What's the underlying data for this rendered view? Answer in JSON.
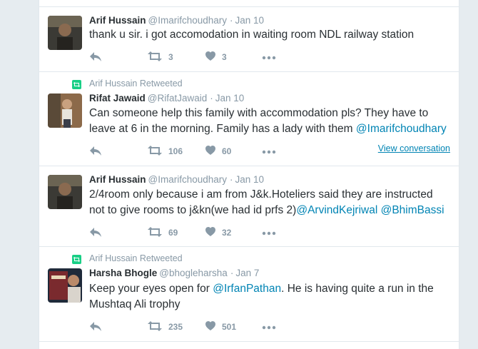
{
  "tweets": [
    {
      "retweet_label": "",
      "fullname": "Arif Hussain",
      "username": "@Imarifchoudhary",
      "time": "Jan 10",
      "text_parts": [
        "thank u sir. i got accomodation in waiting room NDL railway station"
      ],
      "retweets": "3",
      "likes": "3"
    },
    {
      "retweet_label": "Arif Hussain Retweeted",
      "fullname": "Rifat Jawaid",
      "username": "@RifatJawaid",
      "time": "Jan 10",
      "text_parts": [
        "Can someone help this family with accommodation pls? They have to leave at 6 in the morning. Family has a lady with them ",
        "@Imarifchoudhary"
      ],
      "retweets": "106",
      "likes": "60",
      "view_conversation": "View conversation"
    },
    {
      "retweet_label": "",
      "fullname": "Arif Hussain",
      "username": "@Imarifchoudhary",
      "time": "Jan 10",
      "text_parts": [
        "2/4room only because i am from J&k.Hoteliers said they are instructed not to give rooms to j&kn(we had id prfs 2)",
        "@ArvindKejriwal",
        " ",
        "@BhimBassi"
      ],
      "retweets": "69",
      "likes": "32"
    },
    {
      "retweet_label": "Arif Hussain Retweeted",
      "fullname": "Harsha Bhogle",
      "username": "@bhogleharsha",
      "time": "Jan 7",
      "text_parts": [
        "Keep your eyes open for ",
        "@IrfanPathan",
        ". He is having quite a run in the Mushtaq Ali trophy"
      ],
      "retweets": "235",
      "likes": "501"
    }
  ],
  "separator": "·",
  "colors": {
    "link": "#0084b4",
    "muted": "#8899a6",
    "text": "#292f33",
    "retweet_green": "#19cf86",
    "border": "#e1e8ed",
    "background": "#e6ecf0"
  },
  "icons": {
    "reply": "reply-icon",
    "retweet": "retweet-icon",
    "like": "heart-icon",
    "more": "more-icon",
    "retweeted": "retweeted-icon"
  }
}
